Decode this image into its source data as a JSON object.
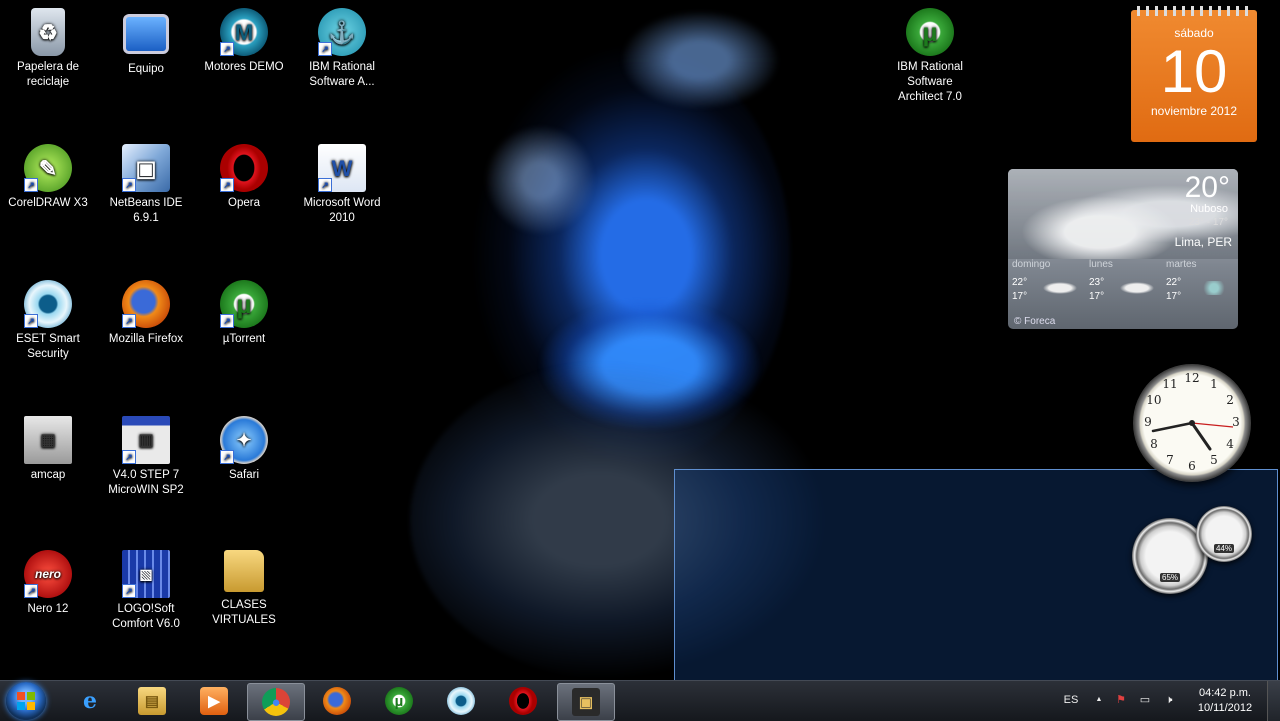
{
  "desktop_icons": [
    {
      "label": "Papelera de reciclaje",
      "icon": "recycle-bin-icon"
    },
    {
      "label": "Equipo",
      "icon": "computer-icon"
    },
    {
      "label": "Motores DEMO",
      "icon": "motores-demo-icon"
    },
    {
      "label": "IBM Rational Software A...",
      "icon": "ibm-rational-icon"
    },
    {
      "label": "IBM Rational Software Architect 7.0",
      "icon": "utorrent-icon"
    },
    {
      "label": "CorelDRAW X3",
      "icon": "coreldraw-icon"
    },
    {
      "label": "NetBeans IDE 6.9.1",
      "icon": "netbeans-icon"
    },
    {
      "label": "Opera",
      "icon": "opera-icon"
    },
    {
      "label": "Microsoft Word 2010",
      "icon": "word-icon"
    },
    {
      "label": "ESET Smart Security",
      "icon": "eset-icon"
    },
    {
      "label": "Mozilla Firefox",
      "icon": "firefox-icon"
    },
    {
      "label": "µTorrent",
      "icon": "utorrent-icon"
    },
    {
      "label": "amcap",
      "icon": "amcap-icon"
    },
    {
      "label": "V4.0 STEP 7 MicroWIN SP2",
      "icon": "microwin-icon"
    },
    {
      "label": "Safari",
      "icon": "safari-icon"
    },
    {
      "label": "Nero 12",
      "icon": "nero-icon"
    },
    {
      "label": "LOGO!Soft Comfort V6.0",
      "icon": "logosoft-icon"
    },
    {
      "label": "CLASES VIRTUALES",
      "icon": "folder-icon"
    }
  ],
  "calendar": {
    "day_of_week": "sábado",
    "day": "10",
    "month_year": "noviembre 2012"
  },
  "weather": {
    "temperature": "20°",
    "condition": "Nuboso",
    "range": "23° - 17°",
    "location": "Lima, PER",
    "forecast": [
      {
        "day": "domingo",
        "high": "22°",
        "low": "17°"
      },
      {
        "day": "lunes",
        "high": "23°",
        "low": "17°"
      },
      {
        "day": "martes",
        "high": "22°",
        "low": "17°"
      }
    ],
    "credit": "© Foreca"
  },
  "clock": {
    "numbers": [
      "12",
      "1",
      "2",
      "3",
      "4",
      "5",
      "6",
      "7",
      "8",
      "9",
      "10",
      "11"
    ],
    "time": "04:42"
  },
  "cpu_meter": {
    "cpu": "65%",
    "memory": "44%"
  },
  "taskbar": {
    "apps": [
      {
        "name": "internet-explorer",
        "glyph": "e"
      },
      {
        "name": "windows-explorer",
        "glyph": "▤"
      },
      {
        "name": "media-player",
        "glyph": "▶"
      },
      {
        "name": "chrome",
        "glyph": "●"
      },
      {
        "name": "firefox",
        "glyph": "◉"
      },
      {
        "name": "utorrent",
        "glyph": "µ"
      },
      {
        "name": "eset",
        "glyph": "◎"
      },
      {
        "name": "opera",
        "glyph": "O"
      },
      {
        "name": "camera-app",
        "glyph": "▣"
      }
    ],
    "language": "ES",
    "tray_arrow": "▲",
    "time": "04:42 p.m.",
    "date": "10/11/2012"
  },
  "colors": {
    "calendar": "#e8771f",
    "taskbar": "#1c2026",
    "selection": "#14468c",
    "accent_blue": "#1e6fe6"
  }
}
